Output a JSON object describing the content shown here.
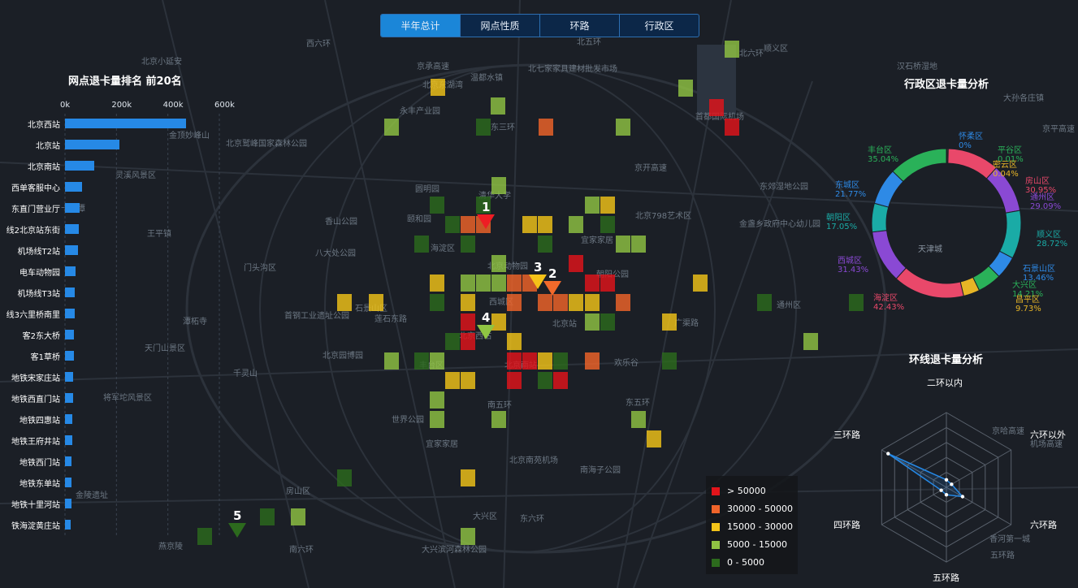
{
  "tabs": [
    {
      "label": "半年总计",
      "active": true
    },
    {
      "label": "网点性质",
      "active": false
    },
    {
      "label": "环路",
      "active": false
    },
    {
      "label": "行政区",
      "active": false
    }
  ],
  "map_labels": [
    "北京小延安",
    "北京鹫峰国家森林公园",
    "金顶妙峰山",
    "灵溪风景区",
    "王平镇",
    "香山公园",
    "八大处公园",
    "门头沟区",
    "颐和园",
    "圆明园",
    "海淀区",
    "清华大学",
    "北京动物园",
    "西城区",
    "北京站",
    "朝阳公园",
    "北京798艺术区",
    "宜家家居",
    "首都国际机场",
    "顺义区",
    "北七家家具建材批发市场",
    "温都水镇",
    "永丰产业园",
    "北京东湖湾",
    "东郊湿地公园",
    "金盏乡政府中心幼儿园",
    "通州区",
    "广渠路",
    "欢乐谷",
    "北京园博园",
    "丰台区",
    "千灵山",
    "石景山区",
    "首钢工业遗址公园",
    "莲石东路",
    "北京西站",
    "北京南站",
    "世界公园",
    "宜家家居",
    "北京南苑机场",
    "南海子公园",
    "房山区",
    "大兴区",
    "大兴滨河森林公园",
    "南六环",
    "金陵遗址",
    "燕京陵",
    "潭柘寺",
    "天门山景区",
    "将军坨风景区",
    "京哈高速",
    "香河第一城",
    "京承高速",
    "京平高速",
    "大孙各庄镇",
    "汉石桥湿地",
    "北五环",
    "北六环",
    "西六环",
    "东五环",
    "东六环",
    "南五环",
    "东三环",
    "京开高速",
    "机场高速",
    "五环路",
    "十八潭"
  ],
  "rank_panel": {
    "title": "网点退卡量排名 前20名",
    "axis_ticks": [
      "0k",
      "200k",
      "400k",
      "600k"
    ],
    "axis_max": 600000,
    "items": [
      {
        "name": "北京西站",
        "value": 470000
      },
      {
        "name": "北京站",
        "value": 210000
      },
      {
        "name": "北京南站",
        "value": 115000
      },
      {
        "name": "西单客服中心",
        "value": 65000
      },
      {
        "name": "东直门营业厅",
        "value": 58000
      },
      {
        "name": "线2北京站东街",
        "value": 55000
      },
      {
        "name": "机场线T2站",
        "value": 52000
      },
      {
        "name": "电车动物园",
        "value": 40000
      },
      {
        "name": "机场线T3站",
        "value": 38000
      },
      {
        "name": "线3六里桥南里",
        "value": 37000
      },
      {
        "name": "客2东大桥",
        "value": 36000
      },
      {
        "name": "客1草桥",
        "value": 35000
      },
      {
        "name": "地铁宋家庄站",
        "value": 33000
      },
      {
        "name": "地铁西直门站",
        "value": 32000
      },
      {
        "name": "地铁四惠站",
        "value": 28000
      },
      {
        "name": "地铁王府井站",
        "value": 27000
      },
      {
        "name": "地铁西门站",
        "value": 26000
      },
      {
        "name": "地铁东单站",
        "value": 25000
      },
      {
        "name": "地铁十里河站",
        "value": 24000
      },
      {
        "name": "铁海淀黄庄站",
        "value": 23000
      }
    ]
  },
  "heat_legend": [
    {
      "label": "> 50000",
      "color": "#e2141b"
    },
    {
      "label": "30000 - 50000",
      "color": "#f0642a"
    },
    {
      "label": "15000 - 30000",
      "color": "#f2c319"
    },
    {
      "label": "5000 - 15000",
      "color": "#8fc243"
    },
    {
      "label": "0 - 5000",
      "color": "#2c6a1d"
    }
  ],
  "markers": [
    {
      "num": "1",
      "color": "#ee1d24"
    },
    {
      "num": "2",
      "color": "#f26a2b"
    },
    {
      "num": "3",
      "color": "#f5c218"
    },
    {
      "num": "4",
      "color": "#8fc443"
    },
    {
      "num": "5",
      "color": "#2c6a1d"
    }
  ],
  "district_panel": {
    "title": "行政区退卡量分析",
    "center_label": "天津城",
    "slices": [
      {
        "name": "怀柔区",
        "pct": "0%",
        "value": 0.1,
        "color": "#2e8ae6"
      },
      {
        "name": "平谷区",
        "pct": "0.01%",
        "value": 0.4,
        "color": "#2ab159"
      },
      {
        "name": "密云区",
        "pct": "0.04%",
        "value": 0.6,
        "color": "#e7b526"
      },
      {
        "name": "房山区",
        "pct": "30.95%",
        "value": 30.95,
        "color": "#e9486a"
      },
      {
        "name": "通州区",
        "pct": "29.09%",
        "value": 29.09,
        "color": "#8a49d4"
      },
      {
        "name": "顺义区",
        "pct": "28.72%",
        "value": 28.72,
        "color": "#1aaba6"
      },
      {
        "name": "石景山区",
        "pct": "13.46%",
        "value": 13.46,
        "color": "#2e8ae6"
      },
      {
        "name": "大兴区",
        "pct": "14.21%",
        "value": 14.21,
        "color": "#2ab159"
      },
      {
        "name": "昌平区",
        "pct": "9.73%",
        "value": 9.73,
        "color": "#e7b526"
      },
      {
        "name": "海淀区",
        "pct": "42.43%",
        "value": 42.43,
        "color": "#e9486a"
      },
      {
        "name": "西城区",
        "pct": "31.43%",
        "value": 31.43,
        "color": "#8a49d4"
      },
      {
        "name": "朝阳区",
        "pct": "17.05%",
        "value": 17.05,
        "color": "#1aaba6"
      },
      {
        "name": "东城区",
        "pct": "21.77%",
        "value": 21.77,
        "color": "#2e8ae6"
      },
      {
        "name": "丰台区",
        "pct": "35.04%",
        "value": 35.04,
        "color": "#2ab159"
      }
    ]
  },
  "ring_panel": {
    "title": "环线退卡量分析",
    "axes": [
      "二环以内",
      "六环以外",
      "六环路",
      "五环路",
      "四环路",
      "三环路"
    ],
    "values": [
      0.1,
      0.08,
      0.25,
      0.1,
      0.08,
      0.9
    ]
  }
}
